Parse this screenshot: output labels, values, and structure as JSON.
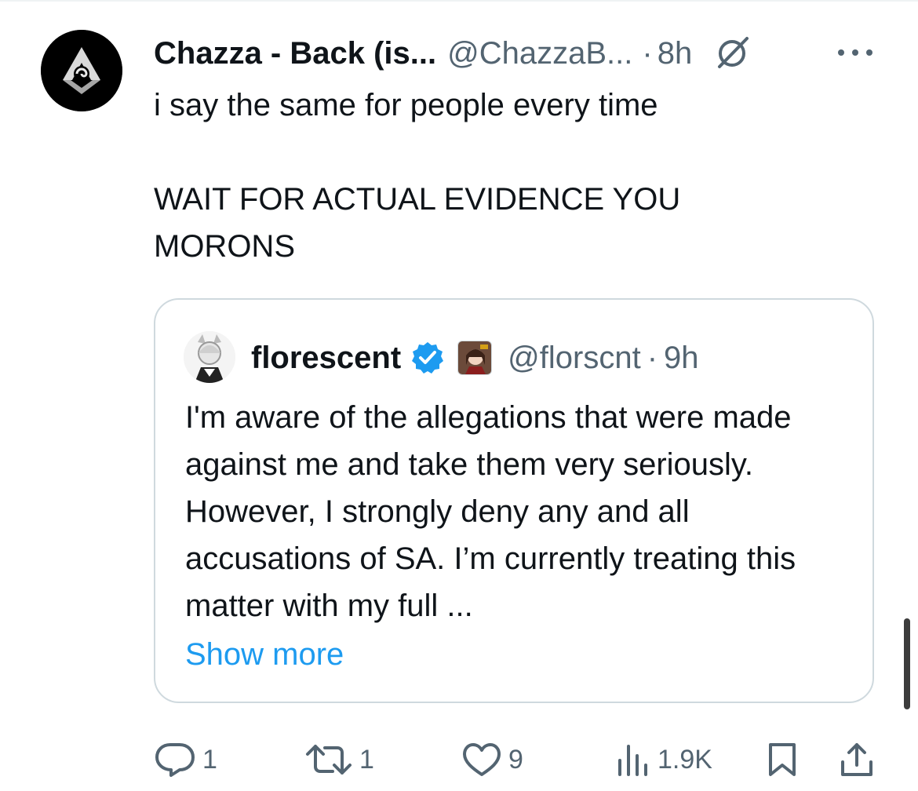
{
  "tweet": {
    "author": {
      "display_name": "Chazza - Back (is...",
      "handle": "@ChazzaB...",
      "avatar_icon": "tri-swirl-logo-avatar"
    },
    "separator": "·",
    "time": "8h",
    "text": "i say the same for people every time\n\nWAIT FOR ACTUAL EVIDENCE YOU\nMORONS",
    "icons": [
      "grok-icon",
      "more-icon"
    ]
  },
  "quote": {
    "author": {
      "display_name": "florescent",
      "handle": "@florscnt",
      "verified": true,
      "verified_color": "#1d9bf0",
      "affiliate_badge": "anime-character-badge"
    },
    "separator": "·",
    "time": "9h",
    "text": "I'm aware of the allegations that were made against me and take them very seriously. However, I strongly deny any and all accusations of SA. I’m currently treating this matter with my full ...",
    "show_more_label": "Show more",
    "link_color": "#1d9bf0"
  },
  "actions": {
    "replies": "1",
    "reposts": "1",
    "likes": "9",
    "views": "1.9K"
  },
  "colors": {
    "text": "#0f1419",
    "secondary": "#536471",
    "border": "#cfd9de"
  }
}
